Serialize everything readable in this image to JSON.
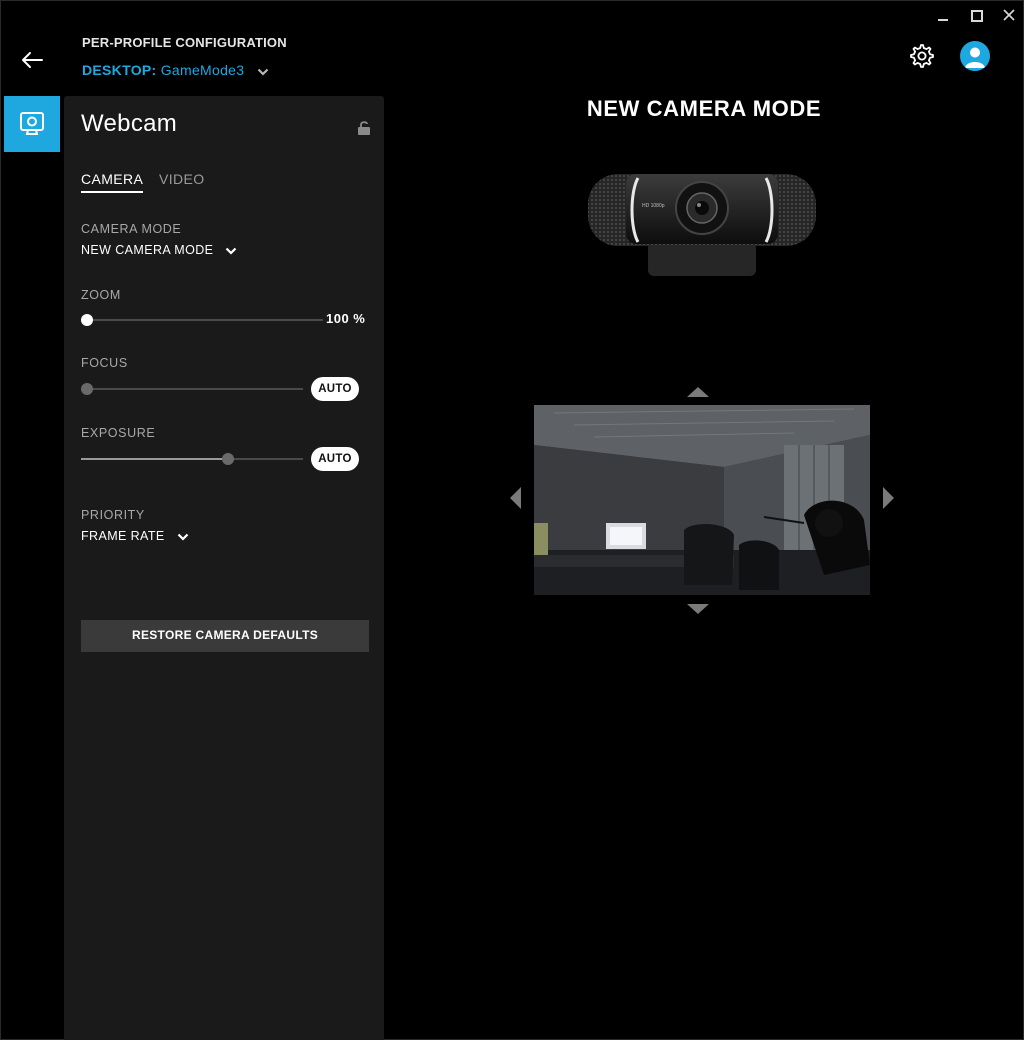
{
  "header": {
    "title": "PER-PROFILE CONFIGURATION",
    "profile_prefix": "DESKTOP:",
    "profile_name": "GameMode3"
  },
  "panel": {
    "title": "Webcam",
    "tabs": [
      {
        "label": "CAMERA",
        "active": true
      },
      {
        "label": "VIDEO",
        "active": false
      }
    ],
    "camera_mode": {
      "label": "CAMERA MODE",
      "value": "NEW CAMERA MODE"
    },
    "zoom": {
      "label": "ZOOM",
      "value": "100 %",
      "level": 0
    },
    "focus": {
      "label": "FOCUS",
      "auto_label": "AUTO",
      "level": 0
    },
    "exposure": {
      "label": "EXPOSURE",
      "auto_label": "AUTO",
      "level": 0.66
    },
    "priority": {
      "label": "PRIORITY",
      "value": "FRAME RATE"
    },
    "restore_label": "RESTORE CAMERA DEFAULTS"
  },
  "main": {
    "mode_title": "NEW CAMERA MODE",
    "webcam_badge": "HD 1080p"
  },
  "colors": {
    "accent": "#1fa8e0",
    "panel_bg": "#1a1a1a",
    "app_bg": "#000000"
  },
  "icons": [
    "back-arrow-icon",
    "chevron-down-icon",
    "gear-icon",
    "user-icon",
    "webcam-icon",
    "lock-icon",
    "minimize-icon",
    "maximize-icon",
    "close-icon"
  ]
}
